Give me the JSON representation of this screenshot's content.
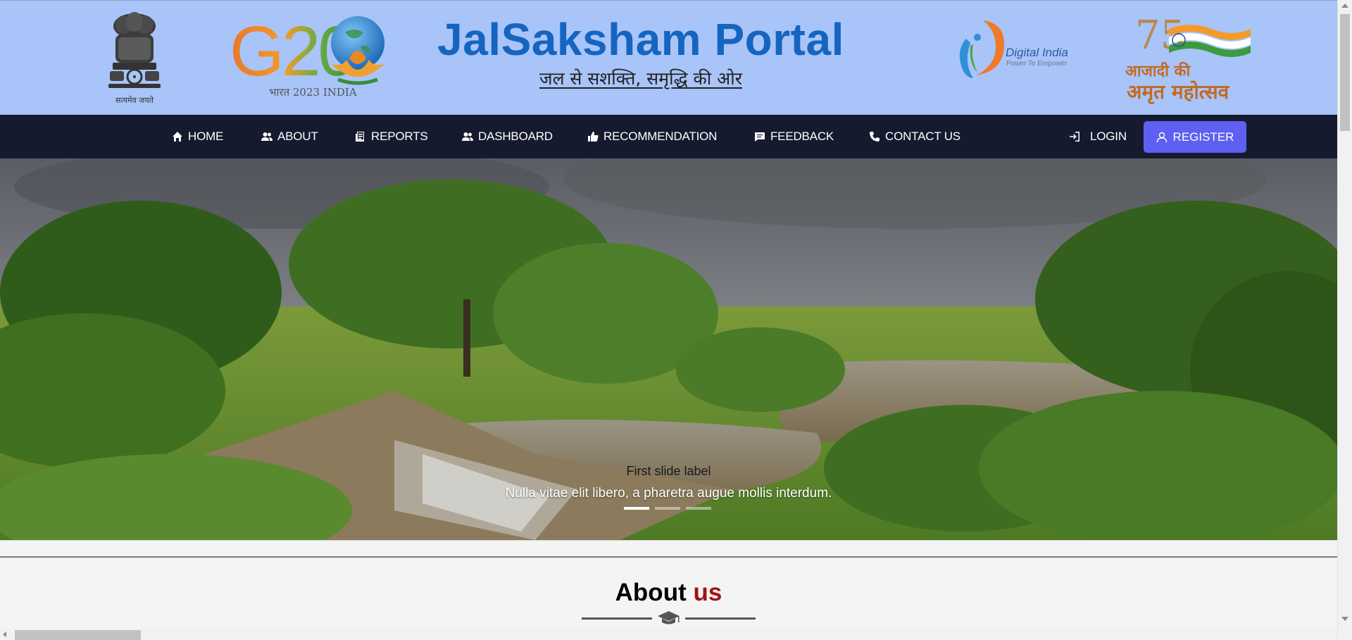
{
  "header": {
    "emblem_caption": "सत्यमेव जयते",
    "g20_text": "G20",
    "g20_caption": "भारत 2023 INDIA",
    "title": "JalSaksham Portal",
    "subtitle": "जल से सशक्ति, समृद्धि की ओर",
    "digital_india_title": "Digital India",
    "digital_india_tagline": "Power To Empower",
    "azadi_number": "75",
    "azadi_line1": "आजादी की",
    "azadi_line2": "अमृत महोत्सव"
  },
  "nav": {
    "items": [
      {
        "label": "HOME",
        "icon": "home-icon"
      },
      {
        "label": "ABOUT",
        "icon": "users-icon"
      },
      {
        "label": "REPORTS",
        "icon": "report-icon"
      },
      {
        "label": "DASHBOARD",
        "icon": "users-icon"
      },
      {
        "label": "RECOMMENDATION",
        "icon": "thumbs-up-icon"
      },
      {
        "label": "FEEDBACK",
        "icon": "chat-icon"
      },
      {
        "label": "CONTACT US",
        "icon": "phone-icon"
      }
    ],
    "login_label": "LOGIN",
    "register_label": "REGISTER"
  },
  "carousel": {
    "caption_title": "First slide label",
    "caption_text": "Nulla vitae elit libero, a pharetra augue mollis interdum.",
    "active_slide": 1,
    "slide_count": 3
  },
  "about": {
    "heading_main": "About",
    "heading_accent": "us"
  },
  "colors": {
    "header_bg": "#a8c4f8",
    "navbar_bg": "#161a2f",
    "title_blue": "#1565c0",
    "register_bg": "#5f5ff2",
    "accent_red": "#a31212"
  }
}
